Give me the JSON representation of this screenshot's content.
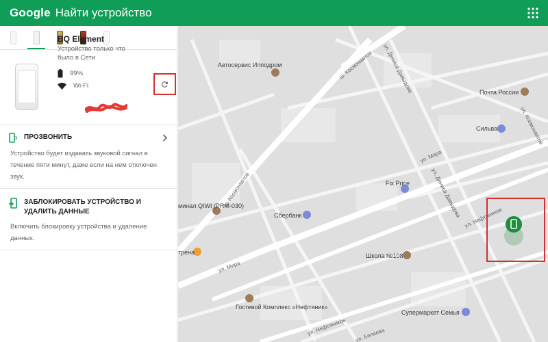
{
  "header": {
    "logo": "Google",
    "title": "Найти устройство"
  },
  "device": {
    "name": "BQ Element",
    "status": "Устройство только что было в Сети",
    "battery": "99%",
    "wifi": "Wi-Fi"
  },
  "actions": [
    {
      "label": "ПРОЗВОНИТЬ",
      "description": "Устройство будет издавать звуковой сигнал в течение пяти минут, даже если на нем отключен звук."
    },
    {
      "label": "ЗАБЛОКИРОВАТЬ УСТРОЙСТВО И УДАЛИТЬ ДАННЫЕ",
      "description": "Включить блокировку устройства и удаление данных."
    }
  ],
  "map": {
    "places": [
      {
        "name": "Автосервис Ипподром"
      },
      {
        "name": "Почта России"
      },
      {
        "name": "Сильва"
      },
      {
        "name": "Fix Price"
      },
      {
        "name": "Сбербанк"
      },
      {
        "name": "Школа №108"
      },
      {
        "name": "минал QIWI (PRM-030)"
      },
      {
        "name": "трена"
      },
      {
        "name": "Гостевой Комплекс «Нефтяник»"
      },
      {
        "name": "Супермаркет Семья"
      }
    ],
    "streets": [
      "ш. Космонавтов",
      "ул. Дениса Давыдова",
      "ул. Космонавтов",
      "ул. Мира",
      "ул. Нефтяников",
      "ул. Беляева",
      "ул. Дениса Давыдова"
    ]
  },
  "colors": {
    "header": "#0f9d58",
    "highlight": "#d32f2f",
    "pin": "#1e8e3e"
  }
}
